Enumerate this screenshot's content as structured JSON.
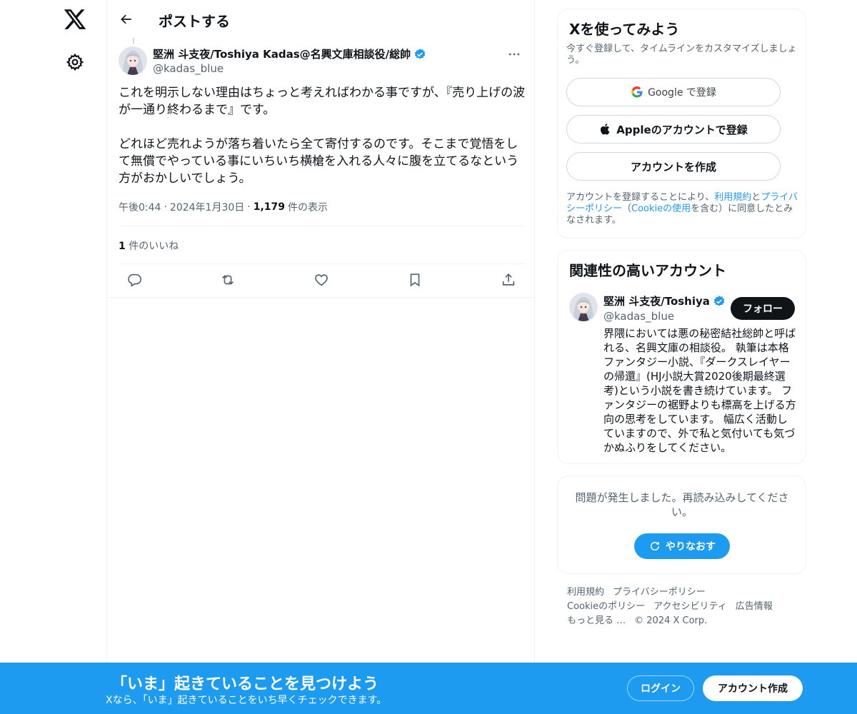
{
  "header": {
    "title": "ポストする"
  },
  "post": {
    "author_name": "堅洲 斗支夜/Toshiya Kadas@名興文庫相談役/総帥",
    "author_handle": "@kadas_blue",
    "text": "これを明示しない理由はちょっと考えればわかる事ですが、『売り上げの波が一通り終わるまで』です。\n\nどれほど売れようが落ち着いたら全て寄付するのです。そこまで覚悟をして無償でやっている事にいちいち横槍を入れる人々に腹を立てるなという方がおかしいでしょう。",
    "time": "午後0:44",
    "date": "2024年1月30日",
    "views_count": "1,179",
    "views_label": "件の表示",
    "likes_count": "1",
    "likes_label": "件のいいね"
  },
  "signup_card": {
    "title": "Xを使ってみよう",
    "subtitle": "今すぐ登録して、タイムラインをカスタマイズしましょう。",
    "google_label": "Google で登録",
    "apple_label": "Appleのアカウントで登録",
    "create_label": "アカウントを作成",
    "legal_pre": "アカウントを登録することにより、",
    "legal_terms": "利用規約",
    "legal_and": "と",
    "legal_privacy": "プライバシーポリシー",
    "legal_paren_open": "（",
    "legal_cookie": "Cookieの使用",
    "legal_post": "を含む）に同意したとみなされます。"
  },
  "related": {
    "title": "関連性の高いアカウント",
    "name": "堅洲 斗支夜/Toshiya",
    "handle": "@kadas_blue",
    "follow_label": "フォロー",
    "bio": "界隈においては悪の秘密結社総帥と呼ばれる、名興文庫の相談役。 執筆は本格ファンタジー小説、『ダークスレイヤーの帰還』(HJ小説大賞2020後期最終選考)という小説を書き続けています。 ファンタジーの裾野よりも標高を上げる方向の思考をしています。 幅広く活動していますので、外で私と気付いても気づかぬふりをしてください。"
  },
  "error_card": {
    "message": "問題が発生しました。再読み込みしてください。",
    "retry_label": "やりなおす"
  },
  "footer": {
    "links": [
      "利用規約",
      "プライバシーポリシー",
      "Cookieのポリシー",
      "アクセシビリティ",
      "広告情報",
      "もっと見る …",
      "© 2024 X Corp."
    ]
  },
  "bottom_bar": {
    "title": "「いま」起きていることを見つけよう",
    "subtitle": "Xなら、「いま」起きていることをいち早くチェックできます。",
    "login_label": "ログイン",
    "signup_label": "アカウント作成"
  },
  "colors": {
    "accent": "#1d9bf0",
    "text": "#0f1419",
    "muted": "#536471",
    "border": "#eff3f4"
  },
  "icons": [
    "x-logo-icon",
    "gear-icon",
    "back-arrow-icon",
    "verified-icon",
    "more-icon",
    "reply-icon",
    "repost-icon",
    "like-icon",
    "bookmark-icon",
    "share-icon",
    "google-icon",
    "apple-icon",
    "refresh-icon"
  ]
}
